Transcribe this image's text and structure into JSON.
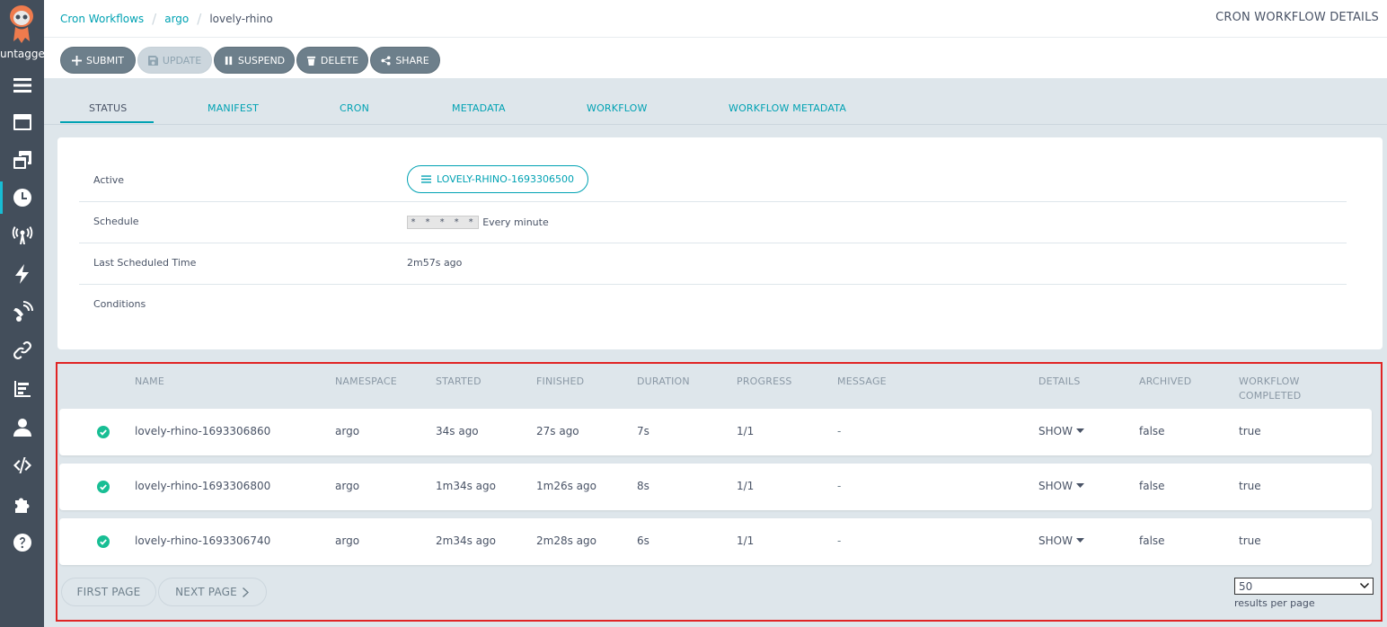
{
  "sidebar": {
    "namespace": "untagged",
    "items": [
      {
        "name": "menu-icon"
      },
      {
        "name": "workflows-icon"
      },
      {
        "name": "workflow-templates-icon"
      },
      {
        "name": "cron-workflows-icon",
        "active": true
      },
      {
        "name": "event-sources-icon"
      },
      {
        "name": "sensors-icon"
      },
      {
        "name": "event-flow-icon"
      },
      {
        "name": "links-icon"
      },
      {
        "name": "reports-icon"
      },
      {
        "name": "user-icon"
      },
      {
        "name": "api-docs-icon"
      },
      {
        "name": "plugins-icon"
      },
      {
        "name": "help-icon"
      }
    ]
  },
  "breadcrumb": {
    "root": "Cron Workflows",
    "namespace": "argo",
    "current": "lovely-rhino"
  },
  "page_title": "CRON WORKFLOW DETAILS",
  "toolbar": {
    "submit": "SUBMIT",
    "update": "UPDATE",
    "suspend": "SUSPEND",
    "delete": "DELETE",
    "share": "SHARE"
  },
  "tabs": [
    "STATUS",
    "MANIFEST",
    "CRON",
    "METADATA",
    "WORKFLOW",
    "WORKFLOW METADATA"
  ],
  "status": {
    "active_label": "Active",
    "active_value": "LOVELY-RHINO-1693306500",
    "schedule_label": "Schedule",
    "schedule_cron": "* * * * *",
    "schedule_text": "Every minute",
    "last_scheduled_label": "Last Scheduled Time",
    "last_scheduled_value": "2m57s ago",
    "conditions_label": "Conditions"
  },
  "workflows": {
    "headers": {
      "name": "NAME",
      "namespace": "NAMESPACE",
      "started": "STARTED",
      "finished": "FINISHED",
      "duration": "DURATION",
      "progress": "PROGRESS",
      "message": "MESSAGE",
      "details": "DETAILS",
      "archived": "ARCHIVED",
      "completed_line1": "WORKFLOW",
      "completed_line2": "COMPLETED"
    },
    "rows": [
      {
        "name": "lovely-rhino-1693306860",
        "namespace": "argo",
        "started": "34s ago",
        "finished": "27s ago",
        "duration": "7s",
        "progress": "1/1",
        "message": "-",
        "details": "SHOW",
        "archived": "false",
        "completed": "true"
      },
      {
        "name": "lovely-rhino-1693306800",
        "namespace": "argo",
        "started": "1m34s ago",
        "finished": "1m26s ago",
        "duration": "8s",
        "progress": "1/1",
        "message": "-",
        "details": "SHOW",
        "archived": "false",
        "completed": "true"
      },
      {
        "name": "lovely-rhino-1693306740",
        "namespace": "argo",
        "started": "2m34s ago",
        "finished": "2m28s ago",
        "duration": "6s",
        "progress": "1/1",
        "message": "-",
        "details": "SHOW",
        "archived": "false",
        "completed": "true"
      }
    ],
    "first_page": "FIRST PAGE",
    "next_page": "NEXT PAGE",
    "per_page_value": "50",
    "per_page_label": "results per page"
  },
  "colors": {
    "accent": "#00a2b3",
    "sidebar": "#434e5b",
    "success": "#18be94",
    "highlight_border": "#e02424"
  }
}
